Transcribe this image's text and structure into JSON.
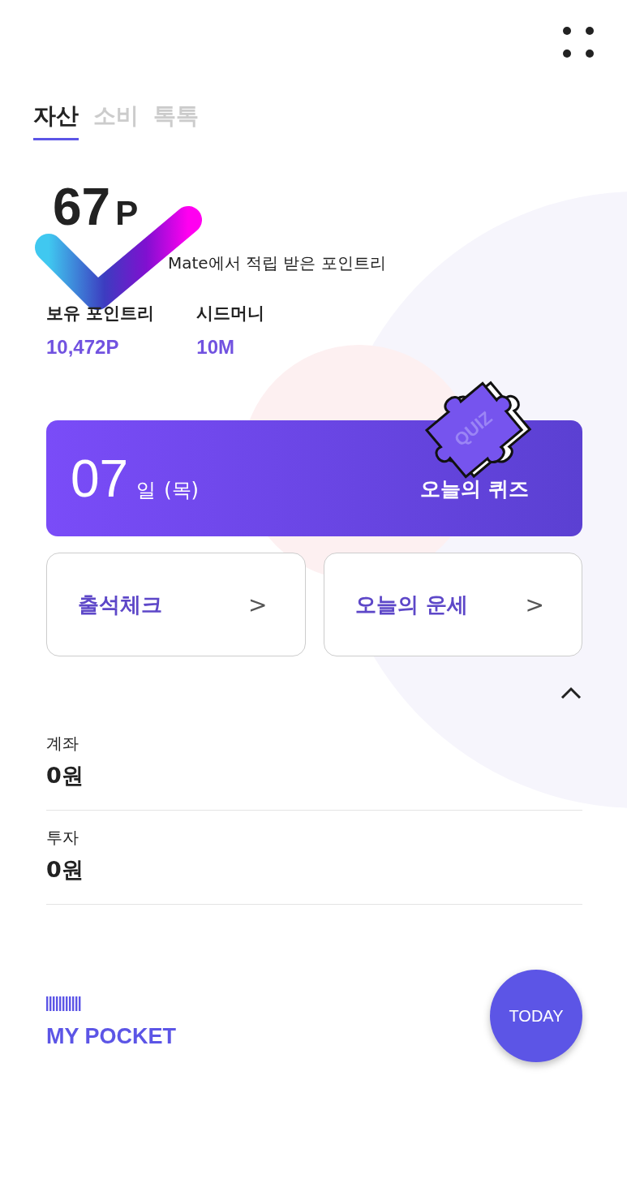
{
  "tabs": [
    {
      "label": "자산",
      "selected": true
    },
    {
      "label": "소비",
      "selected": false
    },
    {
      "label": "톡톡",
      "selected": false
    }
  ],
  "points": {
    "value": "67",
    "unit": "P",
    "caption": "Mate에서 적립 받은 포인트리"
  },
  "stats": [
    {
      "label": "보유 포인트리",
      "value": "10,472P"
    },
    {
      "label": "시드머니",
      "value": "10M"
    }
  ],
  "quiz": {
    "day": "07",
    "day_unit": "일",
    "weekday": "(목)",
    "title": "오늘의 퀴즈",
    "badge": "QUIZ"
  },
  "links": [
    {
      "label": "출석체크",
      "arrow": ">"
    },
    {
      "label": "오늘의 운세",
      "arrow": ">"
    }
  ],
  "accounts": [
    {
      "label": "계좌",
      "value": "0원"
    },
    {
      "label": "투자",
      "value": "0원"
    }
  ],
  "pocket": {
    "title": "MY POCKET"
  },
  "today_button": "TODAY"
}
